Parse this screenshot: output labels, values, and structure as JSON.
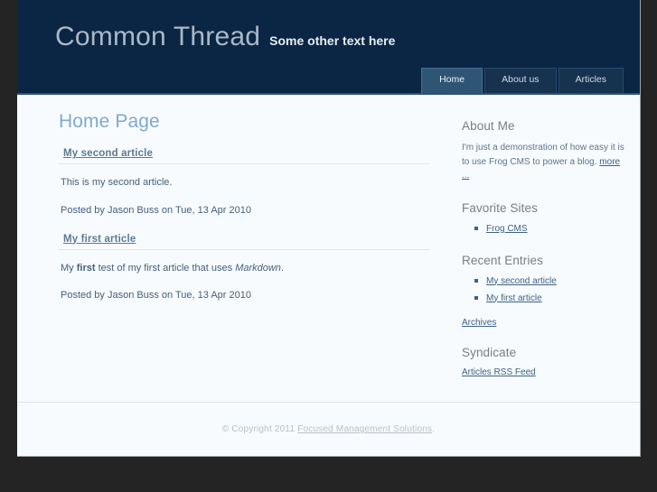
{
  "header": {
    "site_title": "Common Thread",
    "tagline": "Some other text here",
    "nav": [
      {
        "label": "Home",
        "active": true
      },
      {
        "label": "About us",
        "active": false
      },
      {
        "label": "Articles",
        "active": false
      }
    ]
  },
  "content": {
    "page_title": "Home Page",
    "articles": [
      {
        "title": "My second article",
        "body_prefix": "This is my second article.",
        "body_bold": "",
        "body_mid": "",
        "body_italic": "",
        "body_suffix": "",
        "meta": "Posted by Jason Buss on Tue, 13 Apr 2010"
      },
      {
        "title": "My first article",
        "body_prefix": "My ",
        "body_bold": "first",
        "body_mid": " test of my first article that uses ",
        "body_italic": "Markdown",
        "body_suffix": ".",
        "meta": "Posted by Jason Buss on Tue, 13 Apr 2010"
      }
    ]
  },
  "sidebar": {
    "about": {
      "heading": "About Me",
      "text": "I'm just a demonstration of how easy it is to use Frog CMS to power a blog. ",
      "more_label": "more ..."
    },
    "favorites": {
      "heading": "Favorite Sites",
      "items": [
        {
          "label": "Frog CMS"
        }
      ]
    },
    "recent": {
      "heading": "Recent Entries",
      "items": [
        {
          "label": "My second article"
        },
        {
          "label": "My first article"
        }
      ],
      "archives_label": "Archives"
    },
    "syndicate": {
      "heading": "Syndicate",
      "feed_label": "Articles RSS Feed"
    }
  },
  "footer": {
    "copyright": "© Copyright 2011 ",
    "link": "Focused Management Solutions",
    "period": "."
  },
  "colors": {
    "header_bg": "#0b2545",
    "header_rule": "#2d537a",
    "tab_active": "#2e5574",
    "tab_inactive": "#16324f",
    "page_bg": "#f7fbfd",
    "page_title": "#81a9cd",
    "link": "#3f6186",
    "body_text": "#46607c",
    "side_heading": "#7d7d7d",
    "footer_text": "#b9c0c6",
    "outer_bg": "#242424"
  }
}
